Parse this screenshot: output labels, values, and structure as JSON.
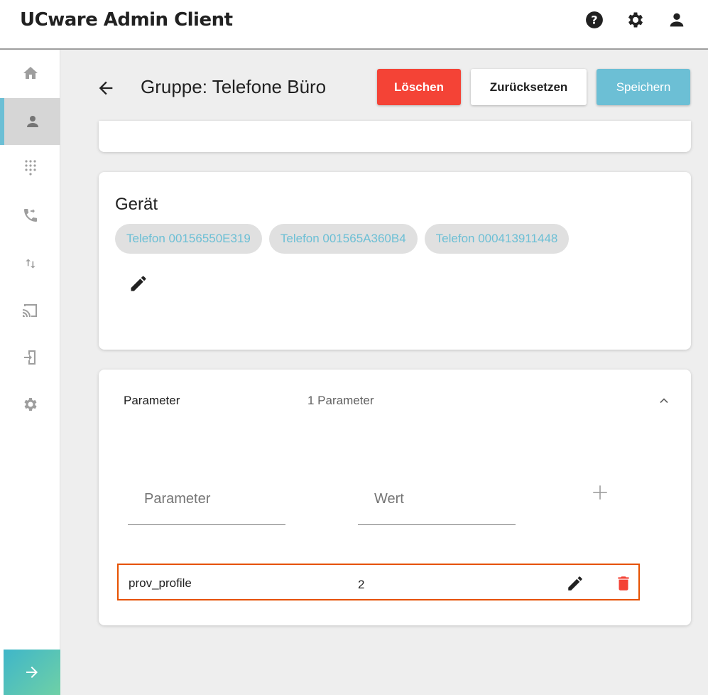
{
  "app": {
    "title": "UCware Admin Client"
  },
  "topbar": {
    "icons": [
      "help-icon",
      "settings-icon",
      "account-icon"
    ]
  },
  "sidebar": {
    "items": [
      {
        "icon": "home-icon",
        "active": false
      },
      {
        "icon": "person-icon",
        "active": true
      },
      {
        "icon": "dialpad-icon",
        "active": false
      },
      {
        "icon": "phone-forward-icon",
        "active": false
      },
      {
        "icon": "swap-vert-icon",
        "active": false
      },
      {
        "icon": "cast-icon",
        "active": false
      },
      {
        "icon": "login-device-icon",
        "active": false
      },
      {
        "icon": "settings-icon",
        "active": false
      }
    ],
    "expand_icon": "arrow-right-icon"
  },
  "header": {
    "title": "Gruppe: Telefone Büro",
    "delete_label": "Löschen",
    "reset_label": "Zurücksetzen",
    "save_label": "Speichern"
  },
  "device": {
    "title": "Gerät",
    "chips": [
      "Telefon 00156550E319",
      "Telefon 001565A360B4",
      "Telefon 000413911448"
    ]
  },
  "parameters": {
    "label": "Parameter",
    "count": "1 Parameter",
    "param_placeholder": "Parameter",
    "value_placeholder": "Wert",
    "rows": [
      {
        "name": "prov_profile",
        "value": "2"
      }
    ]
  },
  "colors": {
    "accent": "#6cbfd5",
    "danger": "#f44336",
    "highlight": "#e65100"
  }
}
